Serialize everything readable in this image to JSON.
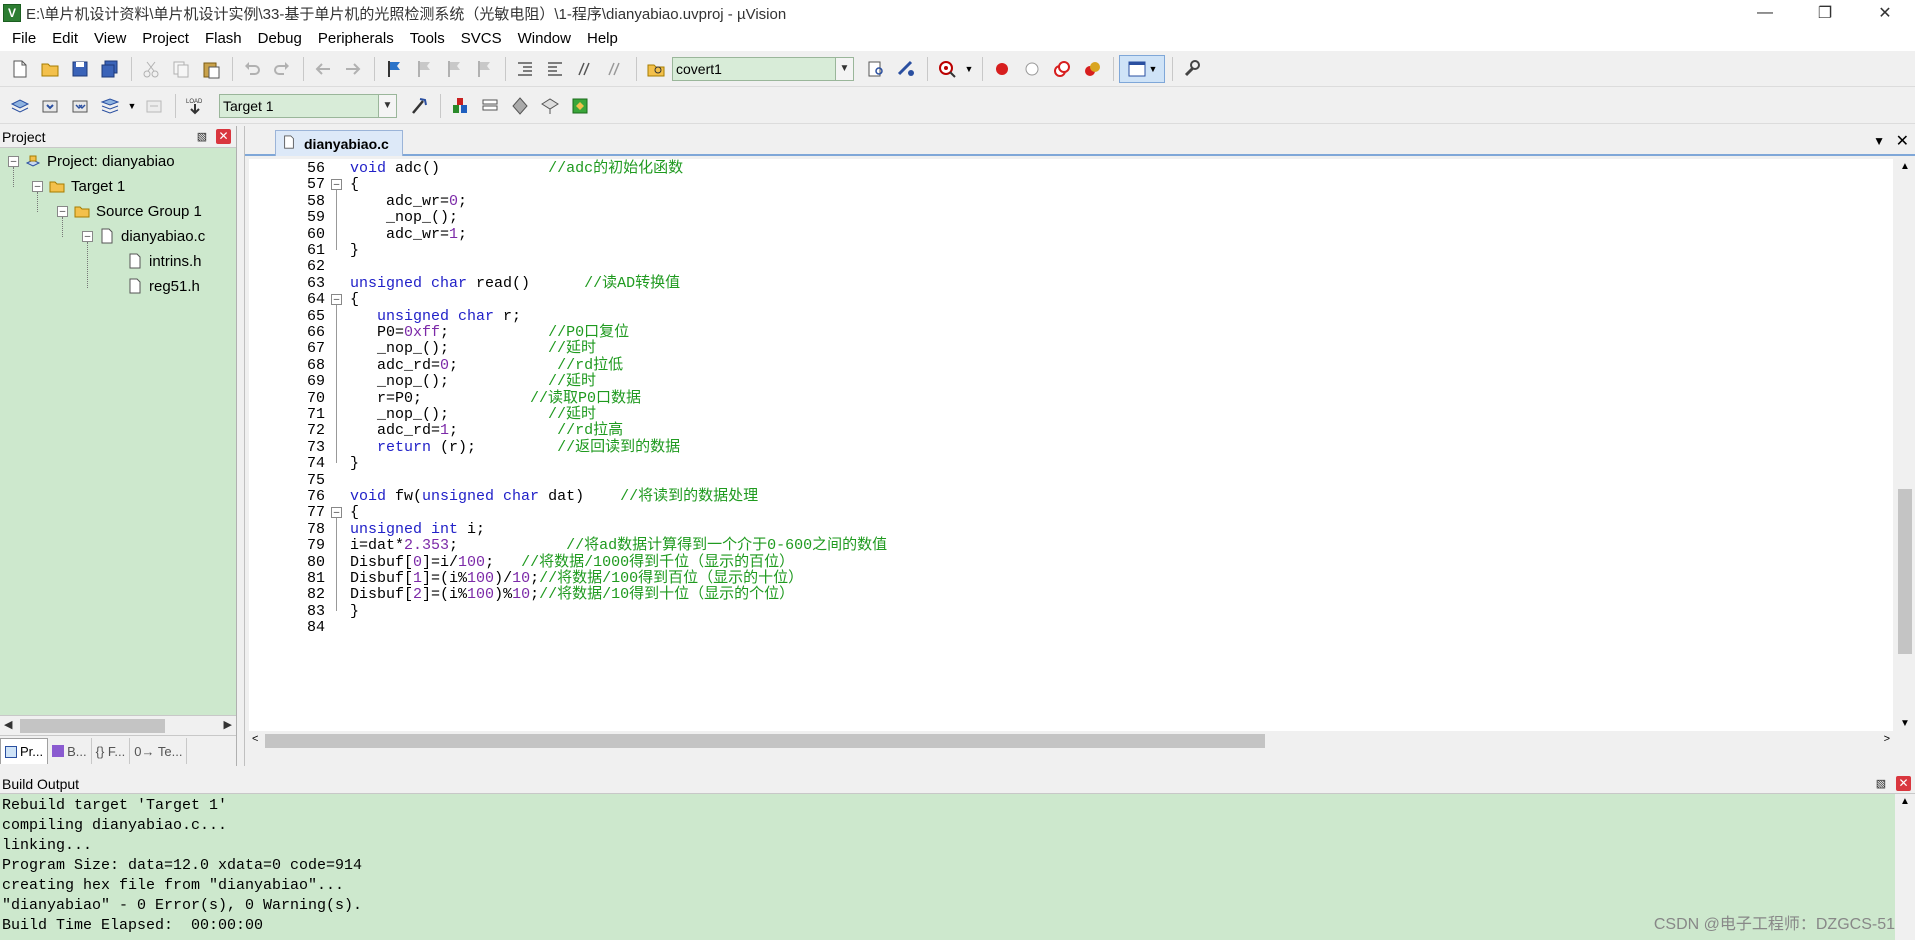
{
  "window": {
    "title": "E:\\单片机设计资料\\单片机设计实例\\33-基于单片机的光照检测系统（光敏电阻）\\1-程序\\dianyabiao.uvproj - µVision"
  },
  "menu": [
    "File",
    "Edit",
    "View",
    "Project",
    "Flash",
    "Debug",
    "Peripherals",
    "Tools",
    "SVCS",
    "Window",
    "Help"
  ],
  "toolbar": {
    "find_combo_value": "covert1",
    "target_combo_value": "Target 1"
  },
  "project_panel": {
    "title": "Project",
    "tree": [
      {
        "label": "Project: dianyabiao",
        "depth": 0,
        "icon": "project-icon"
      },
      {
        "label": "Target 1",
        "depth": 1,
        "icon": "target-icon"
      },
      {
        "label": "Source Group 1",
        "depth": 2,
        "icon": "folder-icon"
      },
      {
        "label": "dianyabiao.c",
        "depth": 3,
        "icon": "file-icon"
      },
      {
        "label": "intrins.h",
        "depth": 4,
        "icon": "file-icon"
      },
      {
        "label": "reg51.h",
        "depth": 4,
        "icon": "file-icon"
      }
    ],
    "tabs": [
      "Pr...",
      "B...",
      "{} F...",
      "0→ Te..."
    ]
  },
  "editor": {
    "active_tab": "dianyabiao.c",
    "lines": [
      {
        "n": "56",
        "tokens": [
          [
            "k",
            "void"
          ],
          [
            "",
            "adc()"
          ],
          [
            "",
            "            "
          ],
          [
            "c",
            "//adc的初始化函数"
          ]
        ]
      },
      {
        "n": "57",
        "tokens": [
          [
            "",
            "{"
          ]
        ]
      },
      {
        "n": "58",
        "tokens": [
          [
            "",
            "    adc_wr="
          ],
          [
            "num",
            "0"
          ],
          [
            "",
            ";"
          ]
        ]
      },
      {
        "n": "59",
        "tokens": [
          [
            "",
            "    _nop_();"
          ]
        ]
      },
      {
        "n": "60",
        "tokens": [
          [
            "",
            "    adc_wr="
          ],
          [
            "num",
            "1"
          ],
          [
            "",
            ";"
          ]
        ]
      },
      {
        "n": "61",
        "tokens": [
          [
            "",
            "}"
          ]
        ]
      },
      {
        "n": "62",
        "tokens": [
          [
            "",
            ""
          ]
        ]
      },
      {
        "n": "63",
        "tokens": [
          [
            "k",
            "unsigned char"
          ],
          [
            "",
            ""
          ],
          [
            "",
            "read()      "
          ],
          [
            "c",
            "//读AD转换值"
          ]
        ]
      },
      {
        "n": "64",
        "tokens": [
          [
            "",
            "{"
          ]
        ]
      },
      {
        "n": "65",
        "tokens": [
          [
            "",
            "   "
          ],
          [
            "k",
            "unsigned char"
          ],
          [
            "",
            ""
          ],
          [
            "",
            "r;"
          ]
        ]
      },
      {
        "n": "66",
        "tokens": [
          [
            "",
            "   P0="
          ],
          [
            "num",
            "0xff"
          ],
          [
            "",
            ";           "
          ],
          [
            "c",
            "//P0口复位"
          ]
        ]
      },
      {
        "n": "67",
        "tokens": [
          [
            "",
            "   _nop_();           "
          ],
          [
            "c",
            "//延时"
          ]
        ]
      },
      {
        "n": "68",
        "tokens": [
          [
            "",
            "   adc_rd="
          ],
          [
            "num",
            "0"
          ],
          [
            "",
            ";           "
          ],
          [
            "c",
            "//rd拉低"
          ]
        ]
      },
      {
        "n": "69",
        "tokens": [
          [
            "",
            "   _nop_();           "
          ],
          [
            "c",
            "//延时"
          ]
        ]
      },
      {
        "n": "70",
        "tokens": [
          [
            "",
            "   r=P0;            "
          ],
          [
            "c",
            "//读取P0口数据"
          ]
        ]
      },
      {
        "n": "71",
        "tokens": [
          [
            "",
            "   _nop_();           "
          ],
          [
            "c",
            "//延时"
          ]
        ]
      },
      {
        "n": "72",
        "tokens": [
          [
            "",
            "   adc_rd="
          ],
          [
            "num",
            "1"
          ],
          [
            "",
            ";           "
          ],
          [
            "c",
            "//rd拉高"
          ]
        ]
      },
      {
        "n": "73",
        "tokens": [
          [
            "",
            "   "
          ],
          [
            "k",
            "return"
          ],
          [
            "",
            "(r);         "
          ],
          [
            "c",
            "//返回读到的数据"
          ]
        ]
      },
      {
        "n": "74",
        "tokens": [
          [
            "",
            "}"
          ]
        ]
      },
      {
        "n": "75",
        "tokens": [
          [
            "",
            ""
          ]
        ]
      },
      {
        "n": "76",
        "tokens": [
          [
            "k",
            "void"
          ],
          [
            "",
            "fw("
          ],
          [
            "k",
            "unsigned char"
          ],
          [
            "",
            ""
          ],
          [
            "",
            "dat)    "
          ],
          [
            "c",
            "//将读到的数据处理"
          ]
        ]
      },
      {
        "n": "77",
        "tokens": [
          [
            "",
            "{"
          ]
        ]
      },
      {
        "n": "78",
        "tokens": [
          [
            "",
            ""
          ],
          [
            "k",
            "unsigned int"
          ],
          [
            "",
            ""
          ],
          [
            "",
            "i;"
          ]
        ]
      },
      {
        "n": "79",
        "tokens": [
          [
            "",
            "i=dat*"
          ],
          [
            "num",
            "2.353"
          ],
          [
            "",
            ";            "
          ],
          [
            "c",
            "//将ad数据计算得到一个介于0-600之间的数值"
          ]
        ]
      },
      {
        "n": "80",
        "tokens": [
          [
            "",
            "Disbuf["
          ],
          [
            "num",
            "0"
          ],
          [
            "",
            "]=i/"
          ],
          [
            "num",
            "100"
          ],
          [
            "",
            ";   "
          ],
          [
            "c",
            "//将数据/1000得到千位（显示的百位）"
          ]
        ]
      },
      {
        "n": "81",
        "tokens": [
          [
            "",
            "Disbuf["
          ],
          [
            "num",
            "1"
          ],
          [
            "",
            "]=(i%"
          ],
          [
            "num",
            "100"
          ],
          [
            "",
            ")/"
          ],
          [
            "num",
            "10"
          ],
          [
            "",
            ";"
          ],
          [
            "c",
            "//将数据/100得到百位（显示的十位）"
          ]
        ]
      },
      {
        "n": "82",
        "tokens": [
          [
            "",
            "Disbuf["
          ],
          [
            "num",
            "2"
          ],
          [
            "",
            "]=(i%"
          ],
          [
            "num",
            "100"
          ],
          [
            "",
            ")%"
          ],
          [
            "num",
            "10"
          ],
          [
            "",
            ";"
          ],
          [
            "c",
            "//将数据/10得到十位（显示的个位）"
          ]
        ]
      },
      {
        "n": "83",
        "tokens": [
          [
            "",
            "}"
          ]
        ]
      },
      {
        "n": "84",
        "tokens": [
          [
            "",
            ""
          ]
        ]
      }
    ]
  },
  "build_output": {
    "title": "Build Output",
    "lines": [
      "Rebuild target 'Target 1'",
      "compiling dianyabiao.c...",
      "linking...",
      "Program Size: data=12.0 xdata=0 code=914",
      "creating hex file from \"dianyabiao\"...",
      "\"dianyabiao\" - 0 Error(s), 0 Warning(s).",
      "Build Time Elapsed:  00:00:00"
    ]
  },
  "watermark": "CSDN @电子工程师：DZGCS-51",
  "colors": {
    "panel_bg": "#cde8cd",
    "keyword": "#2121c8",
    "comment": "#1f9a1f",
    "number": "#7c2aa8"
  }
}
